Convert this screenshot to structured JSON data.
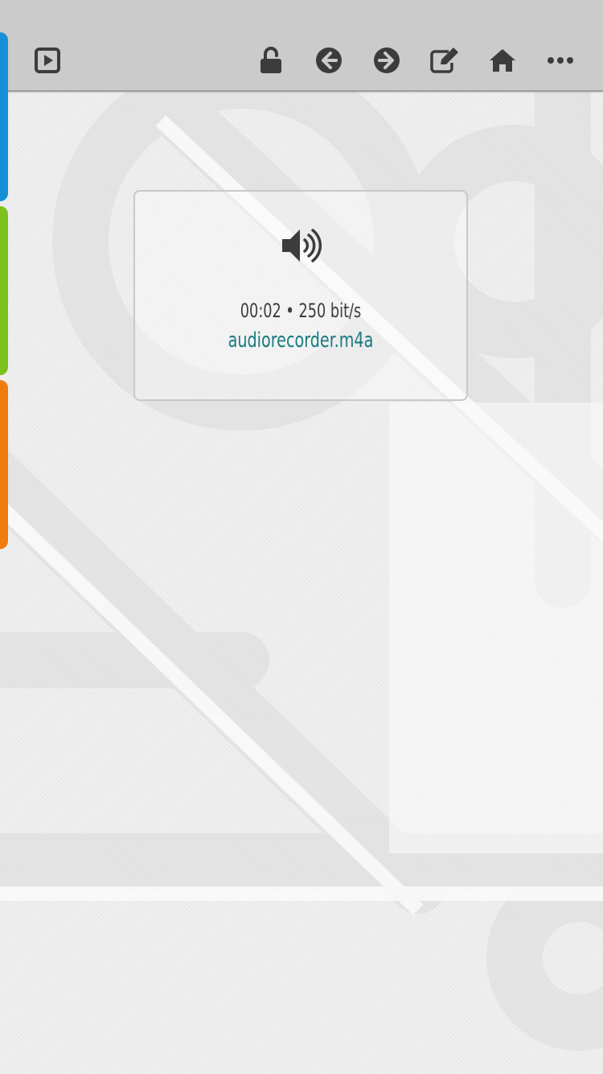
{
  "toolbar": {
    "left_icon": "play-square-icon",
    "right_icons": [
      "unlock-icon",
      "arrow-left-circle-icon",
      "arrow-right-circle-icon",
      "edit-icon",
      "home-icon",
      "more-icon"
    ]
  },
  "side_tabs": {
    "colors": [
      "#1590d8",
      "#7cc21a",
      "#f07c0c"
    ]
  },
  "media": {
    "icon": "speaker-icon",
    "duration": "00:02",
    "separator": "•",
    "bitrate": "250 bit/s",
    "meta_text": "00:02 • 250 bit/s",
    "filename": "audiorecorder.m4a"
  },
  "colors": {
    "toolbar_bg": "#cbcbcb",
    "icon": "#3c3c3c",
    "link": "#1a7a80"
  }
}
